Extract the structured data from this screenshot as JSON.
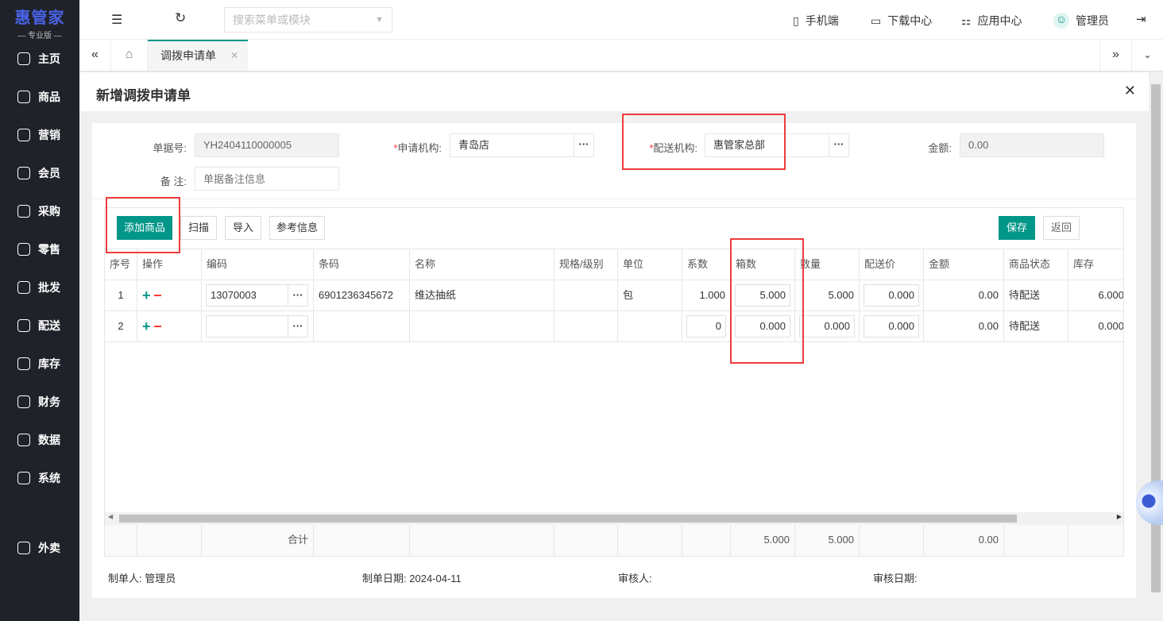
{
  "logo": {
    "title": "惠管家",
    "subtitle": "— 专业版 —"
  },
  "sidebar": {
    "items": [
      {
        "label": "主页",
        "icon": "home-icon"
      },
      {
        "label": "商品",
        "icon": "cube-icon"
      },
      {
        "label": "营销",
        "icon": "chart-icon"
      },
      {
        "label": "会员",
        "icon": "heart-icon"
      },
      {
        "label": "采购",
        "icon": "cart-icon"
      },
      {
        "label": "零售",
        "icon": "bag-icon"
      },
      {
        "label": "批发",
        "icon": "building-icon"
      },
      {
        "label": "配送",
        "icon": "truck-icon"
      },
      {
        "label": "库存",
        "icon": "box-icon"
      },
      {
        "label": "财务",
        "icon": "yen-icon"
      },
      {
        "label": "数据",
        "icon": "bar-chart-icon"
      },
      {
        "label": "系统",
        "icon": "settings-icon"
      },
      {
        "label": "外卖",
        "icon": "bike-icon"
      }
    ]
  },
  "topbar": {
    "search_placeholder": "搜索菜单或模块",
    "mobile": "手机端",
    "download": "下载中心",
    "apps": "应用中心",
    "user": "管理员"
  },
  "tabs": {
    "active": "调拨申请单"
  },
  "dialog": {
    "title": "新增调拨申请单"
  },
  "form": {
    "doc_no_label": "单据号:",
    "doc_no": "YH2404110000005",
    "apply_org_label": "申请机构:",
    "apply_org": "青岛店",
    "dist_org_label": "配送机构:",
    "dist_org": "惠管家总部",
    "amount_label": "金额:",
    "amount": "0.00",
    "remark_label": "备 注:",
    "remark_placeholder": "单据备注信息",
    "required_mark": "*"
  },
  "toolbar": {
    "add": "添加商品",
    "scan": "扫描",
    "import": "导入",
    "ref": "参考信息",
    "save": "保存",
    "back": "返回"
  },
  "table": {
    "headers": [
      "序号",
      "操作",
      "编码",
      "条码",
      "名称",
      "规格/级别",
      "单位",
      "系数",
      "箱数",
      "数量",
      "配送价",
      "金额",
      "商品状态",
      "库存"
    ],
    "rows": [
      {
        "no": "1",
        "code": "13070003",
        "barcode": "6901236345672",
        "name": "维达抽纸",
        "spec": "",
        "unit": "包",
        "factor": "1.000",
        "boxes": "5.000",
        "qty": "5.000",
        "price": "0.000",
        "amount": "0.00",
        "status": "待配送",
        "stock": "6.000"
      },
      {
        "no": "2",
        "code": "",
        "barcode": "",
        "name": "",
        "spec": "",
        "unit": "",
        "factor": "0",
        "boxes": "0.000",
        "qty": "0.000",
        "price": "0.000",
        "amount": "0.00",
        "status": "待配送",
        "stock": "0.000"
      }
    ],
    "total_label": "合计",
    "total_boxes": "5.000",
    "total_qty": "5.000",
    "total_amount": "0.00"
  },
  "footer": {
    "maker_label": "制单人:",
    "maker": "管理员",
    "date_label": "制单日期:",
    "date": "2024-04-11",
    "auditor_label": "审核人:",
    "audit_date_label": "审核日期:"
  }
}
